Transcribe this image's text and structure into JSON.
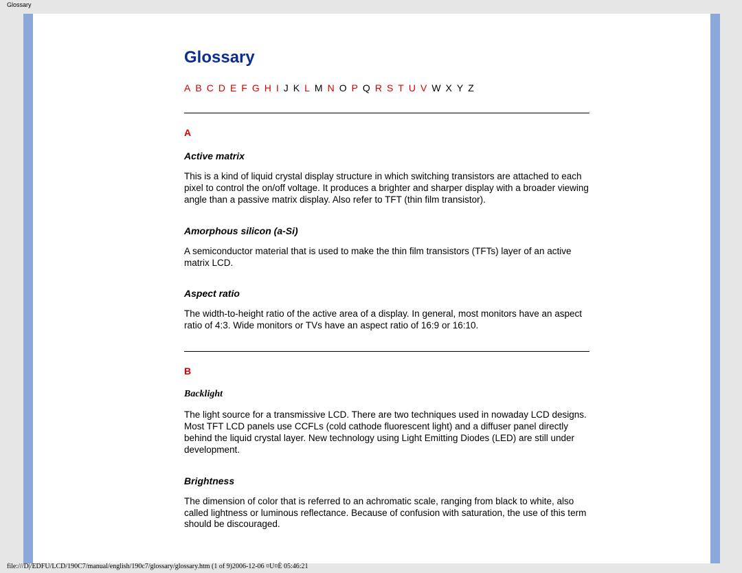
{
  "topLabel": "Glossary",
  "title": "Glossary",
  "nav": [
    {
      "l": "A",
      "active": true
    },
    {
      "l": "B",
      "active": true
    },
    {
      "l": "C",
      "active": true
    },
    {
      "l": "D",
      "active": true
    },
    {
      "l": "E",
      "active": true
    },
    {
      "l": "F",
      "active": true
    },
    {
      "l": "G",
      "active": true
    },
    {
      "l": "H",
      "active": true
    },
    {
      "l": "I",
      "active": true
    },
    {
      "l": "J",
      "active": false
    },
    {
      "l": "K",
      "active": false
    },
    {
      "l": "L",
      "active": true
    },
    {
      "l": "M",
      "active": false
    },
    {
      "l": "N",
      "active": true
    },
    {
      "l": "O",
      "active": false
    },
    {
      "l": "P",
      "active": true
    },
    {
      "l": "Q",
      "active": false
    },
    {
      "l": "R",
      "active": true
    },
    {
      "l": "S",
      "active": true
    },
    {
      "l": "T",
      "active": true
    },
    {
      "l": "U",
      "active": true
    },
    {
      "l": "V",
      "active": true
    },
    {
      "l": "W",
      "active": false
    },
    {
      "l": "X",
      "active": false
    },
    {
      "l": "Y",
      "active": false
    },
    {
      "l": "Z",
      "active": false
    }
  ],
  "sections": {
    "A": {
      "letter": "A",
      "entries": [
        {
          "term": "Active matrix",
          "def": "This is a kind of liquid crystal display structure in which switching transistors are attached to each pixel to control the on/off voltage. It produces a brighter and sharper display with a broader viewing angle than a passive matrix display. Also refer to TFT (thin film transistor)."
        },
        {
          "term": "Amorphous silicon (a-Si)",
          "def": "A semiconductor material that is used to make the thin film transistors (TFTs) layer of an active matrix LCD."
        },
        {
          "term": "Aspect ratio",
          "def": "The width-to-height ratio of the active area of a display. In general, most monitors have an aspect ratio of 4:3. Wide monitors or TVs have an aspect ratio of 16:9 or 16:10."
        }
      ]
    },
    "B": {
      "letter": "B",
      "entries": [
        {
          "term": "Backlight",
          "def": "The light source for a transmissive LCD. There are two techniques used in nowaday LCD designs. Most TFT LCD panels use CCFLs (cold cathode fluorescent light) and a diffuser panel directly behind the liquid crystal layer. New technology using Light Emitting Diodes (LED) are still under development."
        },
        {
          "term": "Brightness",
          "def": "The dimension of color that is referred to an achromatic scale, ranging from black to white, also called lightness or luminous reflectance. Because of confusion with saturation, the use of this term should be discouraged."
        }
      ]
    }
  },
  "footerPath": "file:///D|/EDFU/LCD/190C7/manual/english/190c7/glossary/glossary.htm (1 of 9)2006-12-06 ¤U¤È 05:46:21"
}
